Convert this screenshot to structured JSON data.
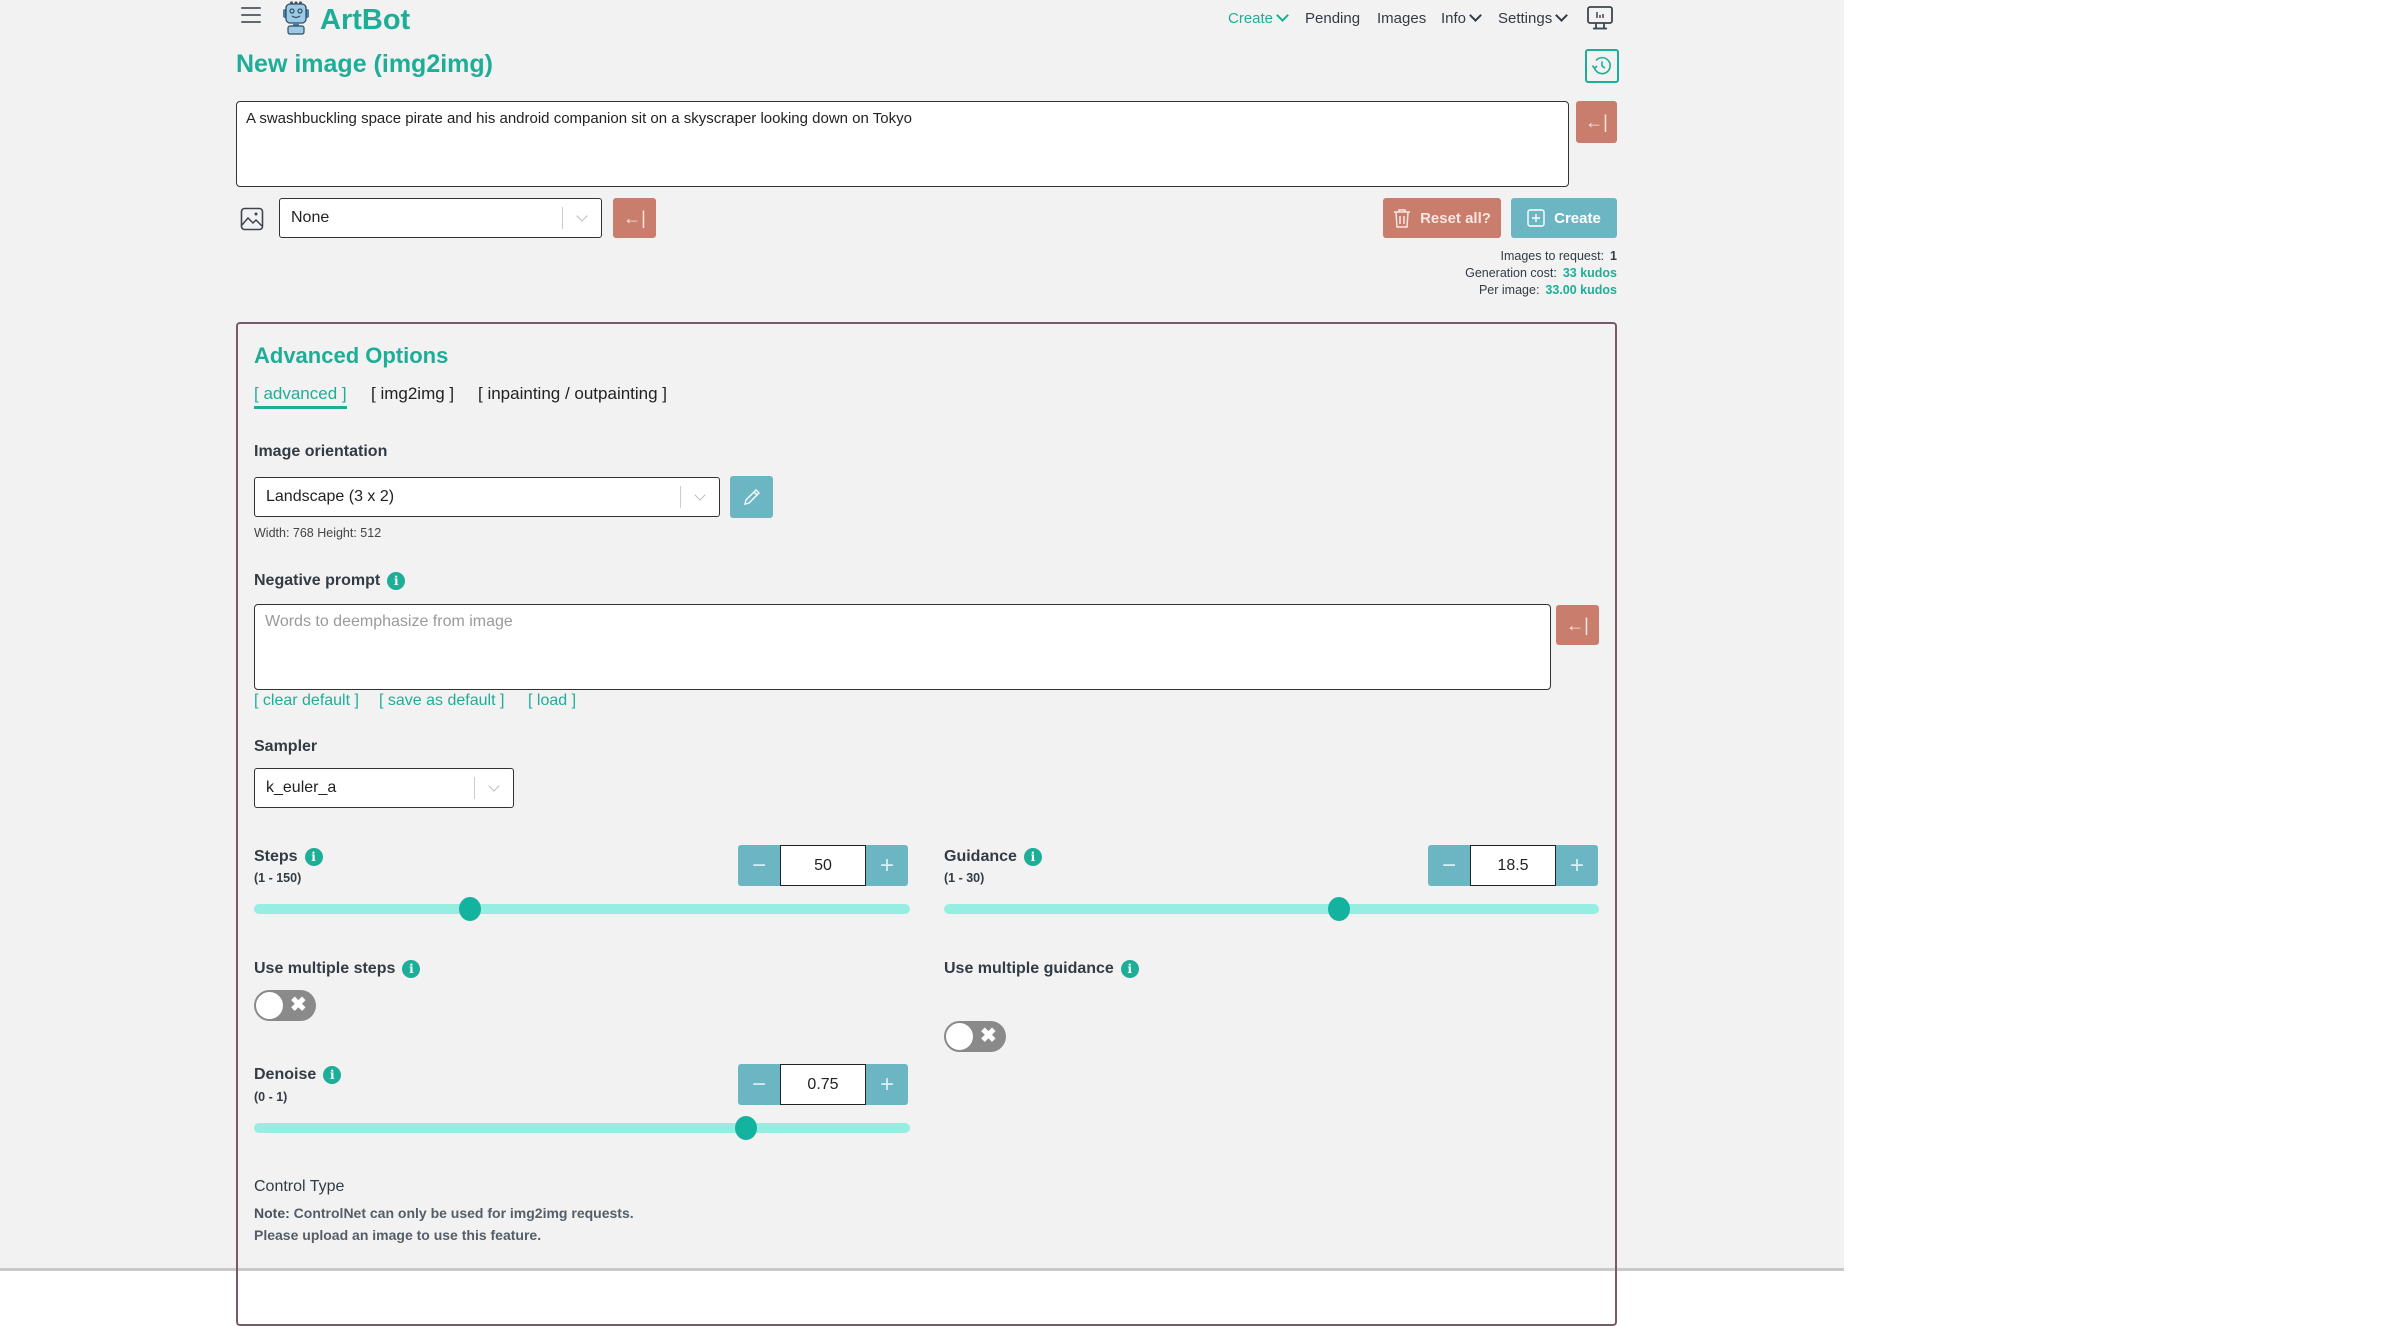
{
  "header": {
    "brand": "ArtBot",
    "nav": [
      {
        "label": "Create",
        "dropdown": true,
        "active": true
      },
      {
        "label": "Pending",
        "dropdown": false
      },
      {
        "label": "Images",
        "dropdown": false
      },
      {
        "label": "Info",
        "dropdown": true
      },
      {
        "label": "Settings",
        "dropdown": true
      }
    ],
    "icons": {
      "menu": "hamburger-icon",
      "logo": "robot-logo",
      "display": "monitor-icon",
      "history": "history-icon"
    }
  },
  "page": {
    "title": "New image (img2img)"
  },
  "prompt": {
    "value": "A swashbuckling space pirate and his android companion sit on a skyscraper looking down on Tokyo",
    "restore_icon": "arrow-left-bar-icon"
  },
  "style_select": {
    "value": "None",
    "icon": "image-icon"
  },
  "actions": {
    "reset_label": "Reset all?",
    "create_label": "Create"
  },
  "stats": {
    "images_label": "Images to request:",
    "images_value": "1",
    "cost_label": "Generation cost:",
    "cost_value": "33 kudos",
    "per_image_label": "Per image:",
    "per_image_value": "33.00 kudos"
  },
  "advanced": {
    "title": "Advanced Options",
    "tabs": [
      {
        "label": "[ advanced ]",
        "active": true
      },
      {
        "label": "[ img2img ]",
        "active": false
      },
      {
        "label": "[ inpainting / outpainting ]",
        "active": false
      }
    ],
    "orientation": {
      "label": "Image orientation",
      "value": "Landscape (3 x 2)",
      "dimensions": "Width: 768 Height: 512"
    },
    "negative_prompt": {
      "label": "Negative prompt",
      "placeholder": "Words to deemphasize from image",
      "value": "",
      "links": [
        "[ clear default ]",
        "[ save as default ]",
        "[ load ]"
      ]
    },
    "sampler": {
      "label": "Sampler",
      "value": "k_euler_a"
    },
    "steps": {
      "label": "Steps",
      "range_text": "(1 - 150)",
      "min": 1,
      "max": 150,
      "value": "50"
    },
    "guidance": {
      "label": "Guidance",
      "range_text": "(1 - 30)",
      "min": 1,
      "max": 30,
      "value": "18.5"
    },
    "multi_steps": {
      "label": "Use multiple steps",
      "enabled": false
    },
    "multi_guidance": {
      "label": "Use multiple guidance",
      "enabled": false
    },
    "denoise": {
      "label": "Denoise",
      "range_text": "(0 - 1)",
      "min": 0,
      "max": 1,
      "value": "0.75"
    },
    "control_type": {
      "label": "Control Type",
      "note_bold": "Note:",
      "note_text": "ControlNet can only be used for img2img requests. Please upload an image to use this feature."
    }
  },
  "colors": {
    "accent": "#1eae98",
    "danger": "#c97d6c",
    "primary_button": "#6cb6c4",
    "slider_track": "#96eee2",
    "panel_border": "#7a5a68",
    "background": "#f2f2f2"
  }
}
